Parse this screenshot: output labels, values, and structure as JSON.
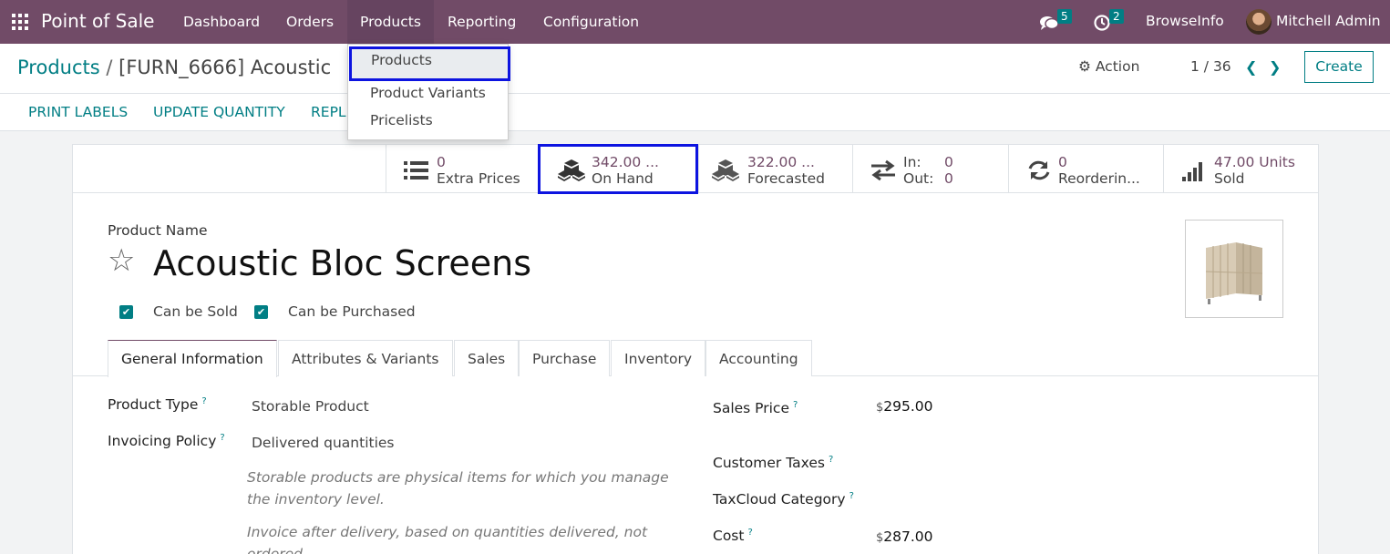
{
  "navbar": {
    "brand": "Point of Sale",
    "menu": [
      "Dashboard",
      "Orders",
      "Products",
      "Reporting",
      "Configuration"
    ],
    "messages_count": "5",
    "activities_count": "2",
    "company": "BrowseInfo",
    "user": "Mitchell Admin"
  },
  "dropdown": {
    "items": [
      "Products",
      "Product Variants",
      "Pricelists"
    ]
  },
  "control": {
    "breadcrumb_parent": "Products",
    "breadcrumb_sep": "/",
    "breadcrumb_current": "[FURN_6666] Acoustic",
    "action_label": "Action",
    "pager": "1 / 36",
    "create_label": "Create"
  },
  "button_bar": [
    "PRINT LABELS",
    "UPDATE QUANTITY",
    "REPL"
  ],
  "stats": [
    {
      "value": "0",
      "label": "Extra Prices",
      "icon": "list-icon"
    },
    {
      "value": "342.00 ...",
      "label": "On Hand",
      "icon": "cubes-icon"
    },
    {
      "value": "322.00 ...",
      "label": "Forecasted",
      "icon": "cubes-icon"
    },
    {
      "in_label": "In:",
      "in_value": "0",
      "out_label": "Out:",
      "out_value": "0",
      "icon": "exchange-icon"
    },
    {
      "value": "0",
      "label": "Reorderin...",
      "icon": "refresh-icon"
    },
    {
      "value": "47.00 Units",
      "label": "Sold",
      "icon": "signal-icon"
    }
  ],
  "product": {
    "name_label": "Product Name",
    "name": "Acoustic Bloc Screens",
    "can_be_sold": "Can be Sold",
    "can_be_purchased": "Can be Purchased"
  },
  "tabs": [
    "General Information",
    "Attributes & Variants",
    "Sales",
    "Purchase",
    "Inventory",
    "Accounting"
  ],
  "general": {
    "product_type_label": "Product Type",
    "product_type": "Storable Product",
    "invoicing_policy_label": "Invoicing Policy",
    "invoicing_policy": "Delivered quantities",
    "help_storable": "Storable products are physical items for which you manage the inventory level.",
    "help_invoice": "Invoice after delivery, based on quantities delivered, not ordered.",
    "sales_price_label": "Sales Price",
    "currency": "$",
    "sales_price": "295.00",
    "customer_taxes_label": "Customer Taxes",
    "taxcloud_label": "TaxCloud Category",
    "cost_label": "Cost",
    "cost": "287.00",
    "help_mark": "?"
  }
}
